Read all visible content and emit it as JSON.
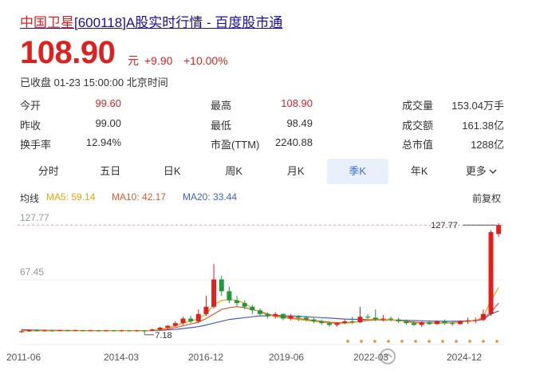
{
  "header": {
    "title_brand": "中国卫星",
    "title_rest": "[600118]A股实时行情 - 百度股市通"
  },
  "quote": {
    "price": "108.90",
    "unit": "元",
    "change": "+9.90",
    "change_pct": "+10.00%",
    "status": "已收盘 01-23 15:00:00 北京时间"
  },
  "stats": [
    {
      "label": "今开",
      "value": "99.60"
    },
    {
      "label": "最高",
      "value": "108.90"
    },
    {
      "label": "成交量",
      "value": "153.04万手"
    },
    {
      "label": "昨收",
      "value": "99.00"
    },
    {
      "label": "最低",
      "value": "98.49"
    },
    {
      "label": "成交额",
      "value": "161.38亿"
    },
    {
      "label": "换手率",
      "value": "12.94%"
    },
    {
      "label": "市盈(TTM)",
      "value": "2240.88"
    },
    {
      "label": "总市值",
      "value": "1288亿"
    }
  ],
  "tabs": [
    "分时",
    "五日",
    "日K",
    "周K",
    "月K",
    "季K",
    "年K",
    "更多"
  ],
  "active_tab": "季K",
  "ma": {
    "label": "均线",
    "ma5": "MA5: 59.14",
    "ma10": "MA10: 42.17",
    "ma20": "MA20: 33.44",
    "adjust": "前复权"
  },
  "colors": {
    "up": "#e0201f",
    "down": "#1d9a3c",
    "ma5": "#f2a20a",
    "ma10": "#e4572e",
    "ma20": "#3f5fd3",
    "accent": "#3b6fd8"
  },
  "chart_data": {
    "type": "candlestick",
    "ymax_label": "127.77",
    "ymid_label": "67.45",
    "min_marker": "7.18",
    "max_marker": "127.77",
    "xticks": [
      "2011-06",
      "2014-03",
      "2016-12",
      "2019-06",
      "2022-03",
      "2024-12"
    ],
    "ylim": [
      0,
      135
    ],
    "candles": [
      [
        10,
        11,
        9.5,
        12
      ],
      [
        11,
        12.5,
        10.5,
        13
      ],
      [
        12.5,
        11.2,
        10.8,
        13.2
      ],
      [
        11.2,
        12,
        10.8,
        12.8
      ],
      [
        12,
        11.5,
        10.5,
        12.6
      ],
      [
        11.5,
        12.2,
        11,
        12.8
      ],
      [
        12.2,
        11.6,
        10.8,
        12.6
      ],
      [
        11.6,
        12.2,
        11,
        12.8
      ],
      [
        12.2,
        11.6,
        10.8,
        12.6
      ],
      [
        11.6,
        12,
        11,
        12.6
      ],
      [
        12,
        11.4,
        10.6,
        12.5
      ],
      [
        11.4,
        12,
        11,
        12.6
      ],
      [
        12,
        11.4,
        10.8,
        12.5
      ],
      [
        11.4,
        12,
        10.6,
        12.6
      ],
      [
        12,
        11.2,
        10.8,
        12.4
      ],
      [
        11.2,
        12,
        10.6,
        12.4
      ],
      [
        12,
        11.5,
        7.18,
        12.4
      ],
      [
        11.5,
        13,
        11,
        14
      ],
      [
        13,
        15,
        12,
        16
      ],
      [
        15,
        17,
        13.5,
        18
      ],
      [
        17,
        20,
        16,
        22
      ],
      [
        20,
        25,
        18,
        27
      ],
      [
        25,
        22,
        20,
        28
      ],
      [
        22,
        30,
        20,
        35
      ],
      [
        30,
        38,
        28,
        50
      ],
      [
        38,
        68,
        36,
        85
      ],
      [
        68,
        55,
        50,
        72
      ],
      [
        55,
        45,
        42,
        60
      ],
      [
        45,
        42,
        38,
        50
      ],
      [
        42,
        38,
        35,
        45
      ],
      [
        38,
        34,
        30,
        40
      ],
      [
        34,
        30,
        28,
        36
      ],
      [
        30,
        28,
        25,
        32
      ],
      [
        28,
        30,
        25,
        32
      ],
      [
        30,
        25,
        23,
        31
      ],
      [
        25,
        28,
        23,
        30
      ],
      [
        28,
        26,
        22,
        29
      ],
      [
        26,
        24,
        22,
        28
      ],
      [
        24,
        22,
        20,
        26
      ],
      [
        22,
        20,
        18,
        24
      ],
      [
        20,
        18,
        16,
        22
      ],
      [
        18,
        20,
        16,
        21
      ],
      [
        20,
        22,
        19,
        24
      ],
      [
        22,
        21,
        19,
        27
      ],
      [
        21,
        27,
        20,
        38
      ],
      [
        27,
        26,
        24,
        30
      ],
      [
        26,
        24,
        22,
        35
      ],
      [
        24,
        25,
        22,
        29
      ],
      [
        25,
        24,
        22,
        27
      ],
      [
        24,
        22,
        20,
        26
      ],
      [
        22,
        20,
        18,
        24
      ],
      [
        20,
        18,
        17,
        22
      ],
      [
        18,
        21,
        16,
        22
      ],
      [
        21,
        19,
        18,
        23
      ],
      [
        19,
        22,
        18,
        23
      ],
      [
        22,
        20,
        18,
        24
      ],
      [
        20,
        19,
        17,
        22
      ],
      [
        19,
        22,
        18,
        23
      ],
      [
        22,
        23,
        19,
        26
      ],
      [
        23,
        23.5,
        20,
        26
      ],
      [
        23.5,
        30,
        22,
        35
      ],
      [
        30,
        120,
        28,
        122
      ],
      [
        118,
        127.77,
        115,
        130
      ]
    ],
    "ma20": [
      13,
      12.5,
      12.3,
      12.2,
      12.1,
      12,
      11.9,
      11.8,
      11.8,
      11.7,
      11.7,
      11.7,
      11.6,
      11.6,
      11.6,
      11.6,
      11.6,
      11.8,
      12,
      12.5,
      13,
      14,
      15,
      16,
      18,
      20,
      22,
      24,
      25,
      26,
      27,
      28,
      28,
      28.5,
      28,
      28,
      27.5,
      27,
      26.5,
      26,
      25.5,
      25,
      24.5,
      24.2,
      24,
      24,
      23.8,
      23.6,
      23.4,
      23.2,
      23,
      22.8,
      22.5,
      22.3,
      22.2,
      22,
      22,
      22.2,
      22.5,
      22.8,
      24,
      30,
      33.44
    ],
    "ma10": [
      12,
      12,
      11.8,
      11.8,
      11.8,
      11.8,
      11.7,
      11.7,
      11.7,
      11.7,
      11.6,
      11.6,
      11.6,
      11.6,
      11.6,
      11.6,
      11.5,
      12,
      12.5,
      13.5,
      15,
      17,
      19,
      21,
      25,
      30,
      35,
      37,
      38,
      37,
      35,
      33,
      30,
      28,
      27,
      26,
      25,
      24,
      23,
      22,
      21,
      20.5,
      20.5,
      21,
      22,
      23,
      23.5,
      23.5,
      23.2,
      22.8,
      22,
      21,
      20.5,
      20.2,
      20.2,
      20.2,
      20.5,
      21,
      22,
      22.5,
      25,
      32,
      42.17
    ],
    "ma5": [
      11.5,
      11.5,
      11.5,
      11.5,
      11.5,
      11.5,
      11.5,
      11.5,
      11.5,
      11.5,
      11.5,
      11.5,
      11.5,
      11.5,
      11.5,
      11.5,
      11.3,
      12,
      13,
      14.5,
      17,
      20,
      22,
      25,
      30,
      40,
      45,
      46,
      45,
      42,
      36,
      32,
      29,
      27,
      26,
      25,
      24,
      23,
      22,
      21,
      20,
      19.5,
      20,
      20.5,
      22,
      24,
      24.5,
      24.2,
      23.5,
      23,
      21.5,
      20,
      20,
      20.5,
      20.8,
      20.5,
      20.5,
      21,
      22,
      22.5,
      27,
      45,
      59.14
    ]
  }
}
